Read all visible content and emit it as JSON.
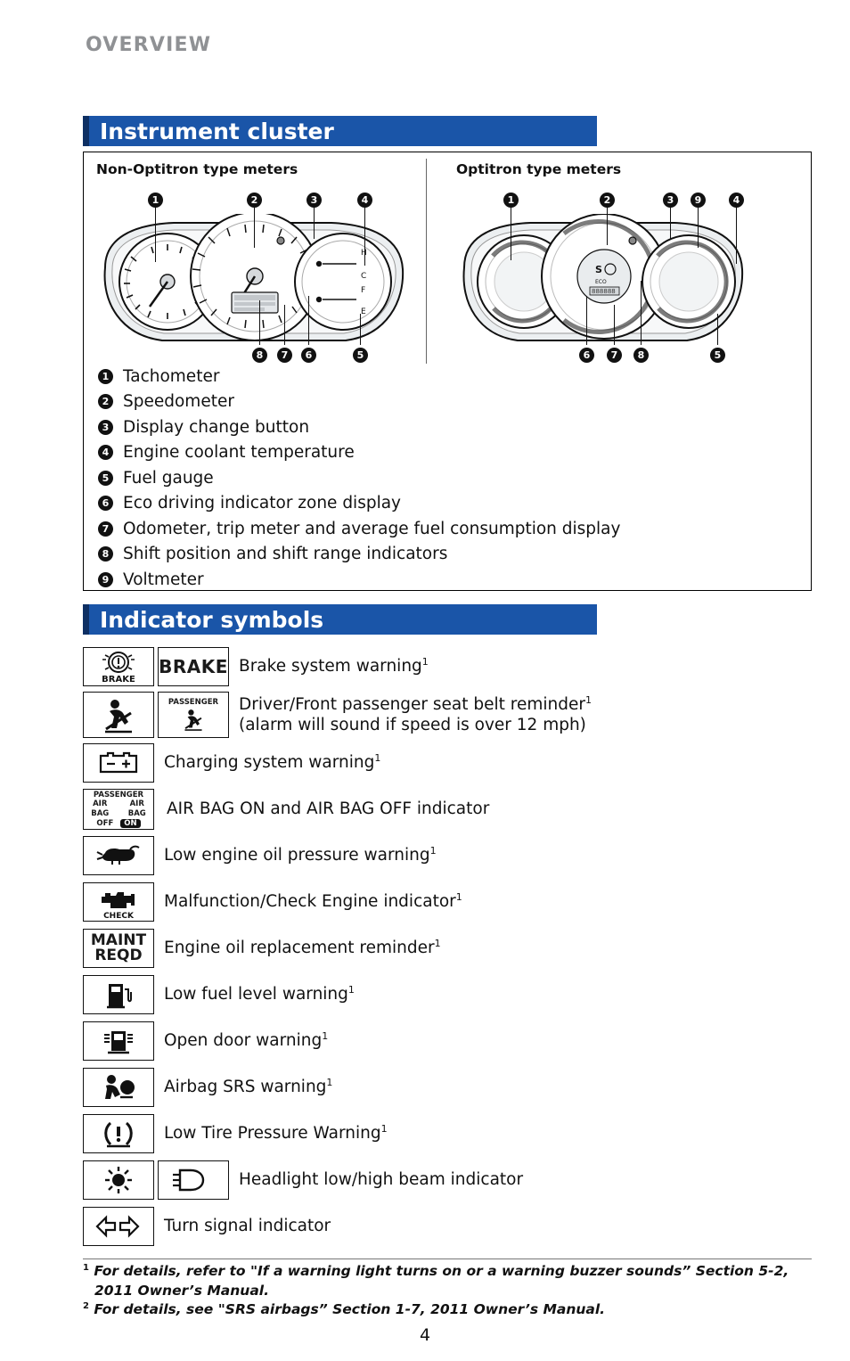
{
  "header": {
    "title": "OVERVIEW"
  },
  "sections": {
    "cluster": {
      "title": "Instrument cluster",
      "left_subtitle": "Non-Optitron type meters",
      "right_subtitle": "Optitron type meters",
      "left_callouts_top": [
        "1",
        "2",
        "3",
        "4"
      ],
      "left_callouts_bottom": [
        "8",
        "7",
        "6",
        "5"
      ],
      "right_callouts_top": [
        "1",
        "2",
        "3",
        "9",
        "4"
      ],
      "right_callouts_bottom": [
        "6",
        "7",
        "8",
        "5"
      ],
      "legend": [
        {
          "num": "1",
          "label": "Tachometer"
        },
        {
          "num": "2",
          "label": "Speedometer"
        },
        {
          "num": "3",
          "label": "Display change button"
        },
        {
          "num": "4",
          "label": "Engine coolant temperature"
        },
        {
          "num": "5",
          "label": "Fuel gauge"
        },
        {
          "num": "6",
          "label": "Eco driving indicator zone display"
        },
        {
          "num": "7",
          "label": "Odometer, trip meter and average fuel consumption display"
        },
        {
          "num": "8",
          "label": "Shift position and shift range indicators"
        },
        {
          "num": "9",
          "label": "Voltmeter"
        }
      ]
    },
    "indicators": {
      "title": "Indicator symbols",
      "rows": [
        {
          "icon1": "brake-warning-icon",
          "icon1_text": "BRAKE",
          "icon2": "brake-word-icon",
          "icon2_text": "BRAKE",
          "label": "Brake system warning",
          "sup": "1"
        },
        {
          "icon1": "seatbelt-reminder-icon",
          "icon2": "passenger-seatbelt-icon",
          "icon2_text": "PASSENGER",
          "label": "Driver/Front passenger seat belt reminder",
          "sup": "1",
          "label_line2": "(alarm will sound if speed is over 12 mph)"
        },
        {
          "icon1": "battery-charging-icon",
          "label": "Charging system warning",
          "sup": "1"
        },
        {
          "icon1": "airbag-on-off-icon",
          "icon1_texts": [
            "PASSENGER",
            "AIR BAG",
            "AIR BAG",
            "OFF",
            "ON"
          ],
          "label": "AIR BAG ON and AIR BAG OFF indicator",
          "sup": ""
        },
        {
          "icon1": "oil-pressure-icon",
          "label": "Low engine oil pressure warning",
          "sup": "1"
        },
        {
          "icon1": "check-engine-icon",
          "icon1_text": "CHECK",
          "label": "Malfunction/Check Engine indicator",
          "sup": "1"
        },
        {
          "icon1": "maint-reqd-icon",
          "icon1_text": "MAINT REQD",
          "label": "Engine oil replacement reminder",
          "sup": "1"
        },
        {
          "icon1": "fuel-pump-icon",
          "label": "Low fuel level warning",
          "sup": "1"
        },
        {
          "icon1": "open-door-icon",
          "label": "Open door warning",
          "sup": "1"
        },
        {
          "icon1": "airbag-srs-icon",
          "label": "Airbag SRS warning",
          "sup": "1"
        },
        {
          "icon1": "tire-pressure-icon",
          "label": "Low Tire Pressure Warning",
          "sup": "1"
        },
        {
          "icon1": "headlight-low-beam-icon",
          "icon2": "headlight-high-beam-icon",
          "label": "Headlight low/high beam indicator",
          "sup": ""
        },
        {
          "icon1": "turn-signal-icon",
          "label": "Turn signal indicator",
          "sup": ""
        }
      ]
    }
  },
  "footnotes": [
    {
      "marker": "1",
      "line1": "For details, refer to \"If a warning light turns on or a warning buzzer sounds” Section 5-2,",
      "line2": "2011 Owner’s Manual."
    },
    {
      "marker": "2",
      "line1": "For details, see \"SRS airbags” Section 1-7, 2011 Owner’s Manual.",
      "line2": ""
    }
  ],
  "page_number": "4",
  "colors": {
    "accent": "#1a55a8",
    "accent_dark": "#0d2f63",
    "header_gray": "#8f9194"
  }
}
